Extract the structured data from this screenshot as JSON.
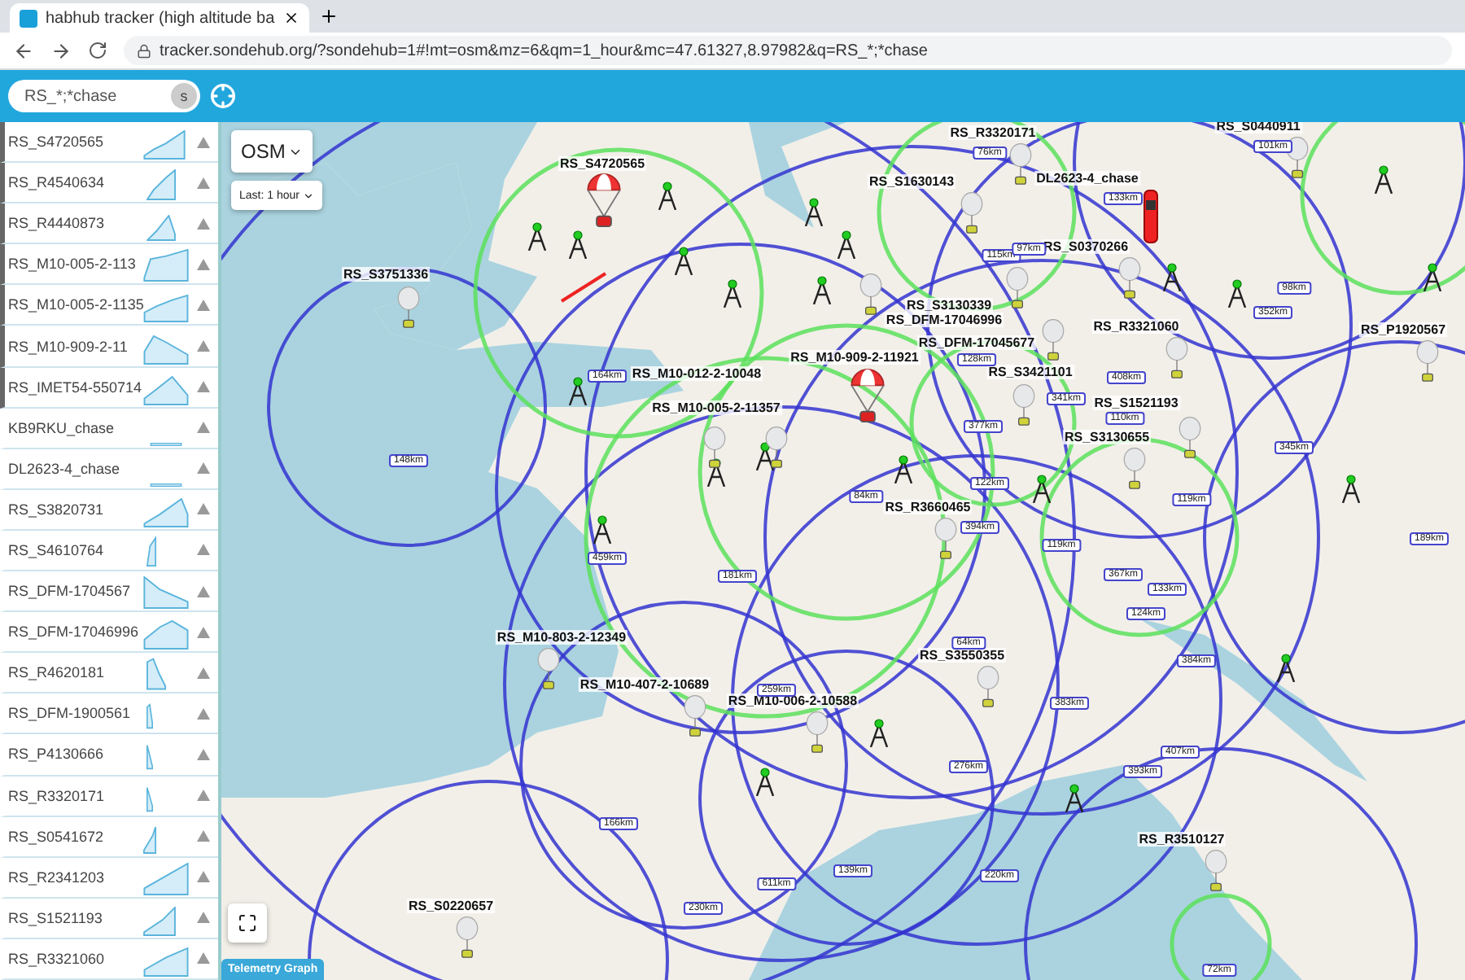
{
  "browser": {
    "tab_title": "habhub tracker (high altitude ba",
    "url": "tracker.sondehub.org/?sondehub=1#!mt=osm&mz=6&qm=1_hour&mc=47.61327,8.97982&q=RS_*;*chase"
  },
  "header": {
    "search_value": "RS_*;*chase",
    "search_button": "s"
  },
  "sidebar": {
    "items": [
      {
        "name": "RS_S4720565",
        "selected": true
      },
      {
        "name": "RS_R4540634",
        "selected": true
      },
      {
        "name": "RS_R4440873",
        "selected": true
      },
      {
        "name": "RS_M10-005-2-113",
        "selected": true
      },
      {
        "name": "RS_M10-005-2-1135",
        "selected": true
      },
      {
        "name": "RS_M10-909-2-11",
        "selected": true
      },
      {
        "name": "RS_IMET54-550714",
        "selected": true
      },
      {
        "name": "KB9RKU_chase",
        "selected": false
      },
      {
        "name": "DL2623-4_chase",
        "selected": false
      },
      {
        "name": "RS_S3820731",
        "selected": false
      },
      {
        "name": "RS_S4610764",
        "selected": false
      },
      {
        "name": "RS_DFM-1704567",
        "selected": false
      },
      {
        "name": "RS_DFM-17046996",
        "selected": false
      },
      {
        "name": "RS_R4620181",
        "selected": false
      },
      {
        "name": "RS_DFM-1900561",
        "selected": false
      },
      {
        "name": "RS_P4130666",
        "selected": false
      },
      {
        "name": "RS_R3320171",
        "selected": false
      },
      {
        "name": "RS_S0541672",
        "selected": false
      },
      {
        "name": "RS_R2341203",
        "selected": false
      },
      {
        "name": "RS_S1521193",
        "selected": false
      },
      {
        "name": "RS_R3321060",
        "selected": false
      }
    ]
  },
  "map": {
    "layer_button": "OSM",
    "time_filter": "Last: 1 hour",
    "telemetry_button": "Telemetry Graph",
    "markers": [
      {
        "label": "RS_S4720565",
        "kind": "parachute"
      },
      {
        "label": "RS_S3751336",
        "kind": "balloon"
      },
      {
        "label": "RS_M10-012-2-10048",
        "kind": "balloon"
      },
      {
        "label": "RS_M10-005-2-11357",
        "kind": "balloon"
      },
      {
        "label": "RS_S1630143",
        "kind": "balloon"
      },
      {
        "label": "RS_R3320171",
        "kind": "balloon"
      },
      {
        "label": "DL2623-4_chase",
        "kind": "car"
      },
      {
        "label": "RS_S0440911",
        "kind": "balloon"
      },
      {
        "label": "RS_S0370266",
        "kind": "balloon"
      },
      {
        "label": "RS_S3130339",
        "kind": "balloon"
      },
      {
        "label": "RS_DFM-17046996",
        "kind": "balloon"
      },
      {
        "label": "RS_DFM-17045677",
        "kind": "balloon"
      },
      {
        "label": "RS_M10-909-2-11921",
        "kind": "parachute"
      },
      {
        "label": "RS_R3321060",
        "kind": "balloon"
      },
      {
        "label": "RS_P1920567",
        "kind": "balloon"
      },
      {
        "label": "RS_S3421101",
        "kind": "balloon"
      },
      {
        "label": "RS_S1521193",
        "kind": "balloon"
      },
      {
        "label": "RS_S3130655",
        "kind": "balloon"
      },
      {
        "label": "RS_R3660465",
        "kind": "balloon"
      },
      {
        "label": "RS_M10-803-2-12349",
        "kind": "balloon"
      },
      {
        "label": "RS_M10-407-2-10689",
        "kind": "balloon"
      },
      {
        "label": "RS_M10-006-2-10588",
        "kind": "balloon"
      },
      {
        "label": "RS_S3550355",
        "kind": "balloon"
      },
      {
        "label": "RS_R3510127",
        "kind": "balloon"
      },
      {
        "label": "RS_S0220657",
        "kind": "balloon"
      }
    ],
    "distance_labels": [
      "164km",
      "148km",
      "459km",
      "181km",
      "76km",
      "115km",
      "97km",
      "133km",
      "101km",
      "98km",
      "352km",
      "128km",
      "408km",
      "341km",
      "110km",
      "377km",
      "345km",
      "122km",
      "84km",
      "119km",
      "394km",
      "119km",
      "367km",
      "133km",
      "189km",
      "124km",
      "64km",
      "259km",
      "384km",
      "383km",
      "407km",
      "393km",
      "276km",
      "166km",
      "139km",
      "220km",
      "611km",
      "230km",
      "72km"
    ]
  }
}
